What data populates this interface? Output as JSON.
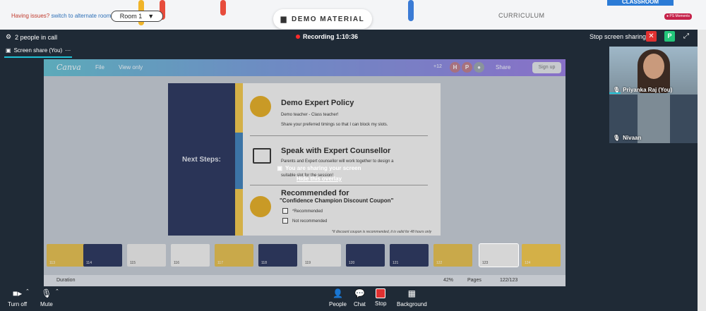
{
  "topbar": {
    "issues_text": "Having issues?",
    "alt_room_link": "switch to alternate room",
    "room_select": "Room 1",
    "demo_tab": "DEMO MATERIAL",
    "curriculum_tab": "CURRICULUM",
    "classroom_tab": "CLASSROOM",
    "ps_moments": "PS Moments"
  },
  "call": {
    "people_count": "2 people in call",
    "recording": "Recording 1:10:36",
    "stop_share": "Stop screen sharing",
    "close_label": "✕",
    "p_label": "P",
    "accent_red": "#e03131",
    "accent_green": "#23c57a"
  },
  "share_tab": {
    "label": "Screen share (You)",
    "more": "⋯"
  },
  "canva": {
    "logo": "Canva",
    "file": "File",
    "view_only": "View only",
    "collab_count": "+12",
    "avatar_h": "H",
    "avatar_p": "P",
    "share": "Share",
    "signup": "Sign up"
  },
  "slide": {
    "next_steps": "Next Steps:",
    "sec1_title": "Demo Expert Policy",
    "sec1_line1": "Demo teacher - Class teacher!",
    "sec1_line2": "Share your preferred timings so that I can block my slots.",
    "sec2_title": "Speak with Expert Counsellor",
    "sec2_line1": "Parents and Expert counsellor will work together to design a",
    "sec2_line2": "suitable slot for the session!",
    "sec3_title": "Recommended for",
    "sec3_subtitle": "\"Confidence Champion Discount Coupon\"",
    "opt1": "*Recommended",
    "opt2": "Not recommended",
    "note": "*if discount coupon is recommended, it is valid for 48 hours only"
  },
  "overlay": {
    "message": "You are sharing your screen",
    "hide": "Hide this overlay"
  },
  "thumbnails": [
    "113",
    "114",
    "115",
    "116",
    "117",
    "118",
    "119",
    "120",
    "121",
    "122",
    "123",
    "124"
  ],
  "canva_footer": {
    "duration": "Duration",
    "zoom": "42%",
    "pages": "Pages",
    "page_num": "122/123"
  },
  "participants": [
    {
      "name": "Priyanka Raj (You)"
    },
    {
      "name": "Nivaan"
    }
  ],
  "toolbar": {
    "turn_off": "Turn off",
    "mute": "Mute",
    "people": "People",
    "chat": "Chat",
    "stop": "Stop",
    "background": "Background"
  }
}
